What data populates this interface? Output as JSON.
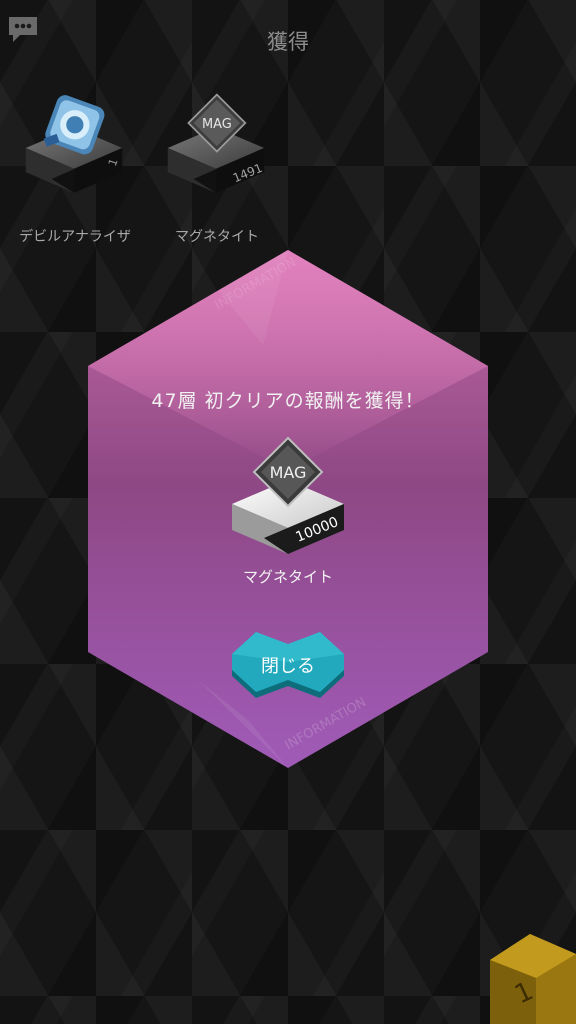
{
  "header": {
    "title": "獲得",
    "chat_icon": "speech-bubble-icon"
  },
  "acquired_items": [
    {
      "name": "デビルアナライザ",
      "count": "1",
      "icon": "devil-analyzer-icon"
    },
    {
      "name": "マグネタイト",
      "count": "1491",
      "icon": "mag-diamond-icon",
      "badge": "MAG"
    }
  ],
  "modal": {
    "message": "47層 初クリアの報酬を獲得！",
    "reward": {
      "name": "マグネタイト",
      "count": "10000",
      "badge": "MAG",
      "icon": "mag-diamond-icon"
    },
    "close_label": "閉じる",
    "watermark_top": "INFORMATION",
    "watermark_bottom": "INFORMATION"
  },
  "colors": {
    "modal_top": "#c05a9b",
    "modal_bottom": "#7a3d8a",
    "close_button": "#1ea7b9",
    "next_button": "#b08a12"
  },
  "corner": {
    "icon": "arrow-next-icon",
    "label": "1"
  }
}
